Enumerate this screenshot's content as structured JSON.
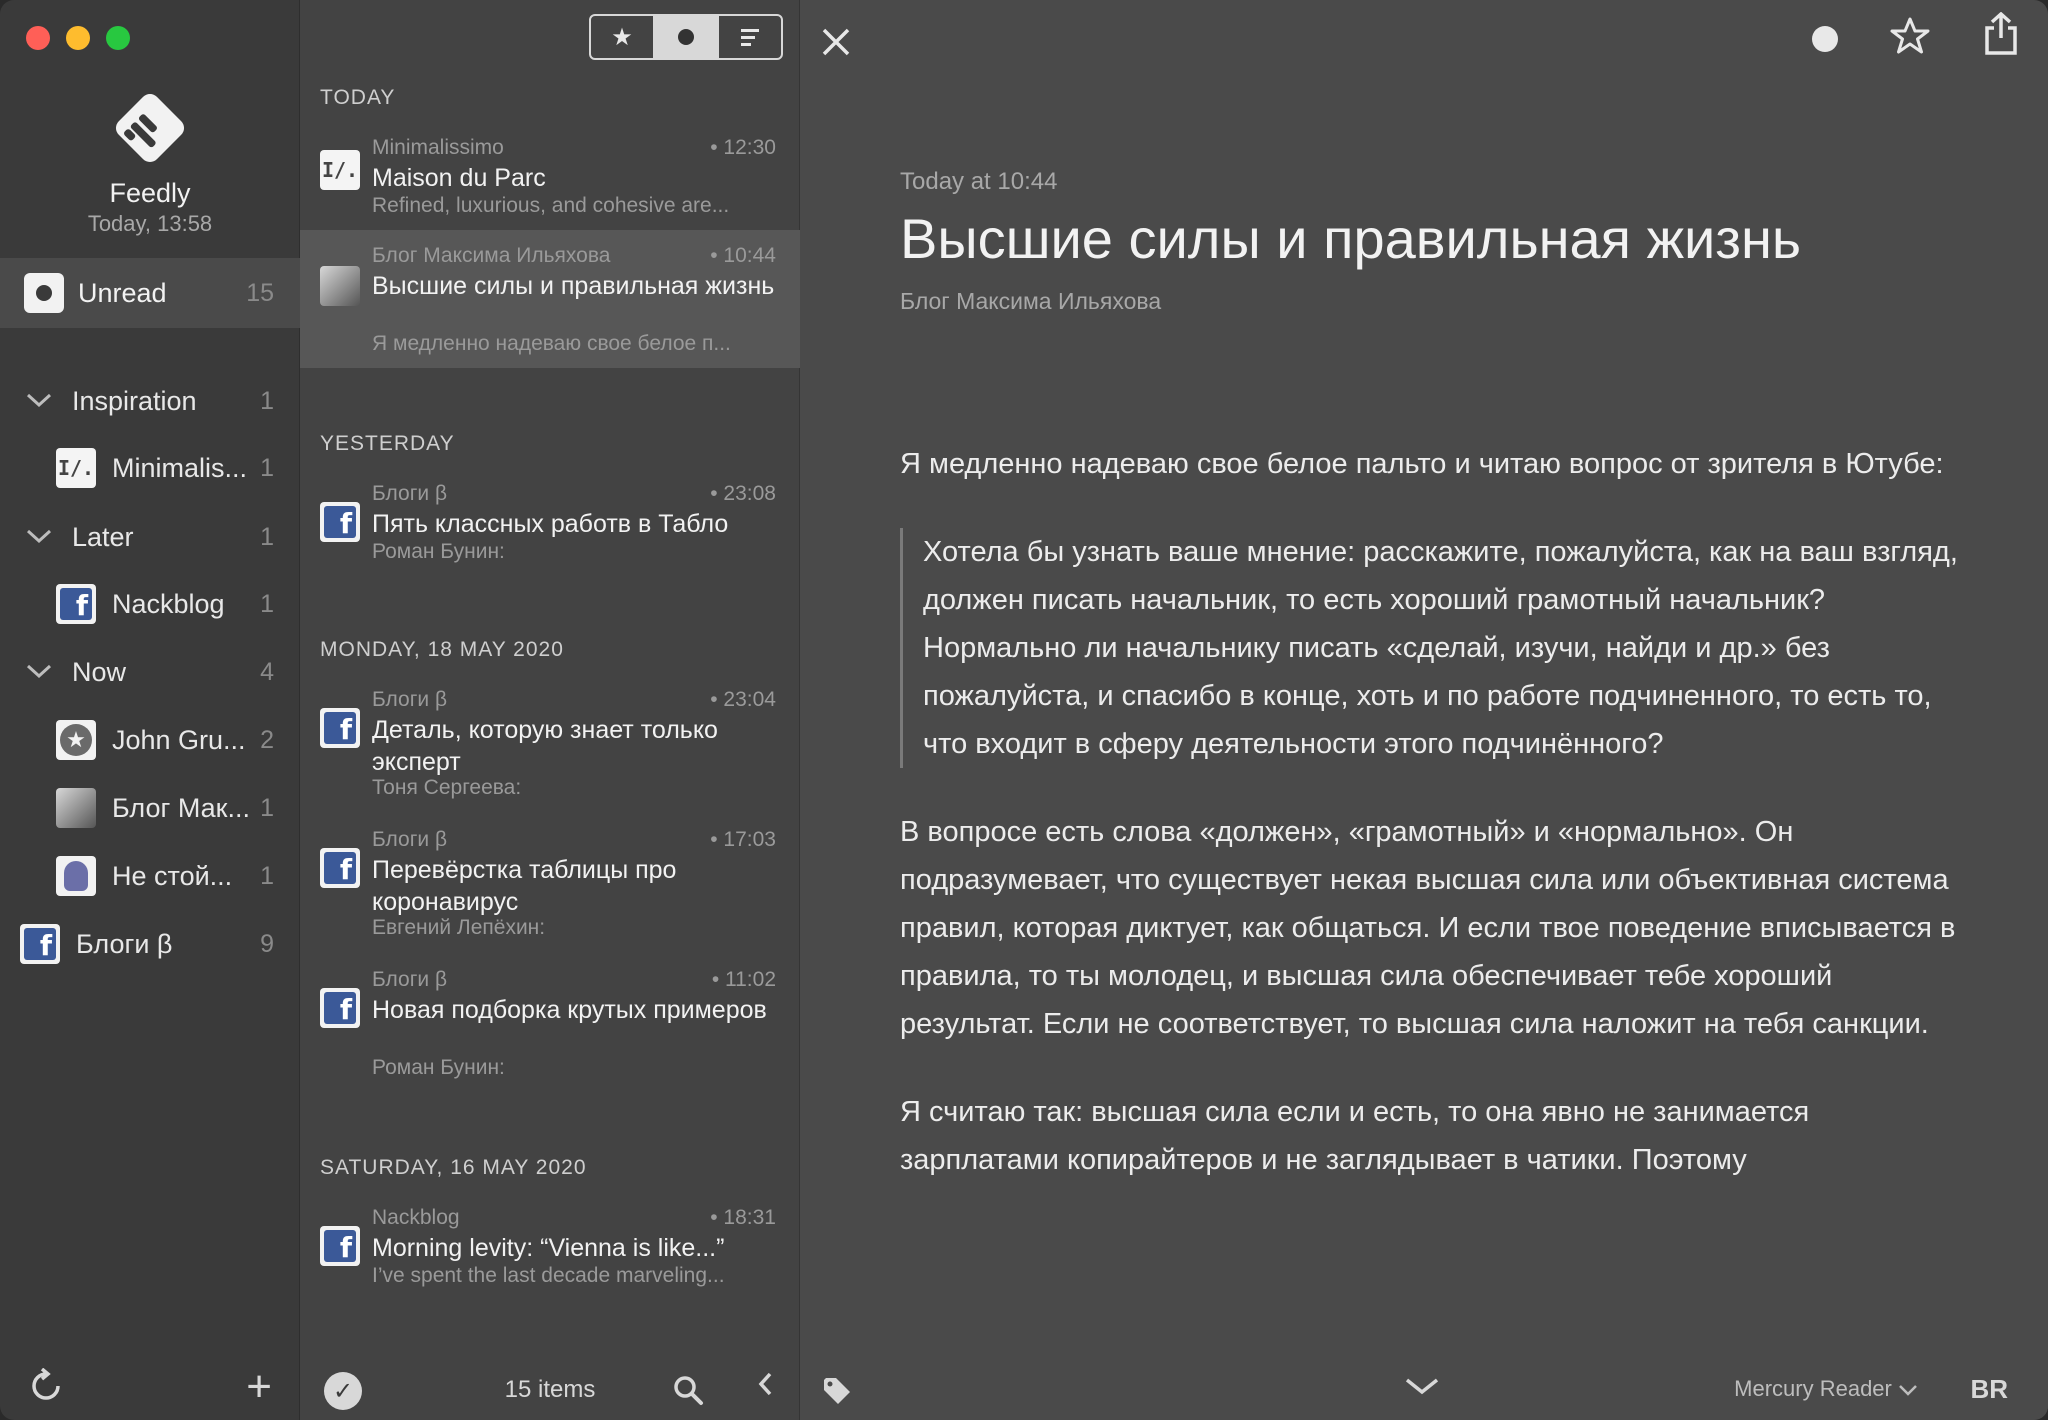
{
  "app": {
    "name": "Feedly",
    "synced": "Today, 13:58"
  },
  "sidebar": {
    "unread": {
      "label": "Unread",
      "count": "15"
    },
    "items": [
      {
        "label": "Inspiration",
        "count": "1",
        "type": "category"
      },
      {
        "label": "Minimalis...",
        "count": "1",
        "type": "feed",
        "icon": "minimalissimo-icon"
      },
      {
        "label": "Later",
        "count": "1",
        "type": "category"
      },
      {
        "label": "Nackblog",
        "count": "1",
        "type": "feed",
        "icon": "facebook-icon"
      },
      {
        "label": "Now",
        "count": "4",
        "type": "category"
      },
      {
        "label": "John Gru...",
        "count": "2",
        "type": "feed",
        "icon": "star-badge-icon"
      },
      {
        "label": "Блог Мак...",
        "count": "1",
        "type": "feed",
        "icon": "avatar-photo-icon"
      },
      {
        "label": "Не стой...",
        "count": "1",
        "type": "feed",
        "icon": "person-icon"
      },
      {
        "label": "Блоги β",
        "count": "9",
        "type": "feed-top",
        "icon": "facebook-icon"
      }
    ]
  },
  "list": {
    "groups": [
      {
        "label": "TODAY"
      },
      {
        "label": "YESTERDAY"
      },
      {
        "label": "MONDAY, 18 MAY 2020"
      },
      {
        "label": "SATURDAY, 16 MAY 2020"
      }
    ],
    "articles": [
      {
        "source": "Minimalissimo",
        "time": "• 12:30",
        "title": "Maison du Parc",
        "snippet": "Refined, luxurious, and cohesive are...",
        "icon": "minimalissimo-icon"
      },
      {
        "source": "Блог Максима Ильяхова",
        "time": "• 10:44",
        "title": "Высшие силы и правильная жизнь",
        "snippet": "Я медленно надеваю свое белое п...",
        "icon": "avatar-photo-icon",
        "selected": true
      },
      {
        "source": "Блоги β",
        "time": "• 23:08",
        "title": "Пять классных работв в Табло",
        "snippet": "Роман Бунин:",
        "icon": "facebook-icon"
      },
      {
        "source": "Блоги β",
        "time": "• 23:04",
        "title": "Деталь, которую знает только эксперт",
        "snippet": "Тоня Сергеева:",
        "icon": "facebook-icon"
      },
      {
        "source": "Блоги β",
        "time": "• 17:03",
        "title": "Перевёрстка таблицы про коронавирус",
        "snippet": "Евгений Лепёхин:",
        "icon": "facebook-icon"
      },
      {
        "source": "Блоги β",
        "time": "• 11:02",
        "title": "Новая подборка крутых примеров",
        "snippet": "Роман Бунин:",
        "icon": "facebook-icon"
      },
      {
        "source": "Nackblog",
        "time": "• 18:31",
        "title": "Morning levity: “Vienna is like...”",
        "snippet": "I’ve spent the last decade marveling...",
        "icon": "facebook-icon"
      }
    ],
    "items_count": "15 items"
  },
  "reader": {
    "date": "Today at 10:44",
    "title": "Высшие силы и правильная жизнь",
    "source": "Блог Максима Ильяхова",
    "para1": "Я медленно надеваю свое белое пальто и читаю вопрос от зрителя в Ютубе:",
    "quote": "Хотела бы узнать ваше мнение: расскажите, пожалуйста, как на ваш взгляд, должен писать начальник, то есть хороший грамотный начальник? Нормально ли начальнику писать «сделай, изучи, найди и др.» без пожалуйста, и спасибо в конце, хоть и по работе подчиненного, то есть то, что входит в сферу деятельности этого подчинённого?",
    "para2": "В вопросе есть слова «должен», «грамотный» и «нормально». Он подразумевает, что существует некая высшая сила или объективная система правил, которая диктует, как общаться. И если твое поведение вписывается в правила, то ты молодец, и высшая сила обеспечивает тебе хороший результат. Если не соответствует, то высшая сила наложит на тебя санкции.",
    "para3": "Я считаю так: высшая сила если и есть, то она явно не занимается зарплатами копирайтеров и не заглядывает в чатики. Поэтому",
    "view_mode": "Mercury Reader",
    "br_label": "BR"
  },
  "colors": {
    "sidebar_bg": "#3a3a3a",
    "list_bg": "#434343",
    "reader_bg": "#4a4a4a",
    "selected_bg": "#575757",
    "facebook_blue": "#3b5998"
  }
}
